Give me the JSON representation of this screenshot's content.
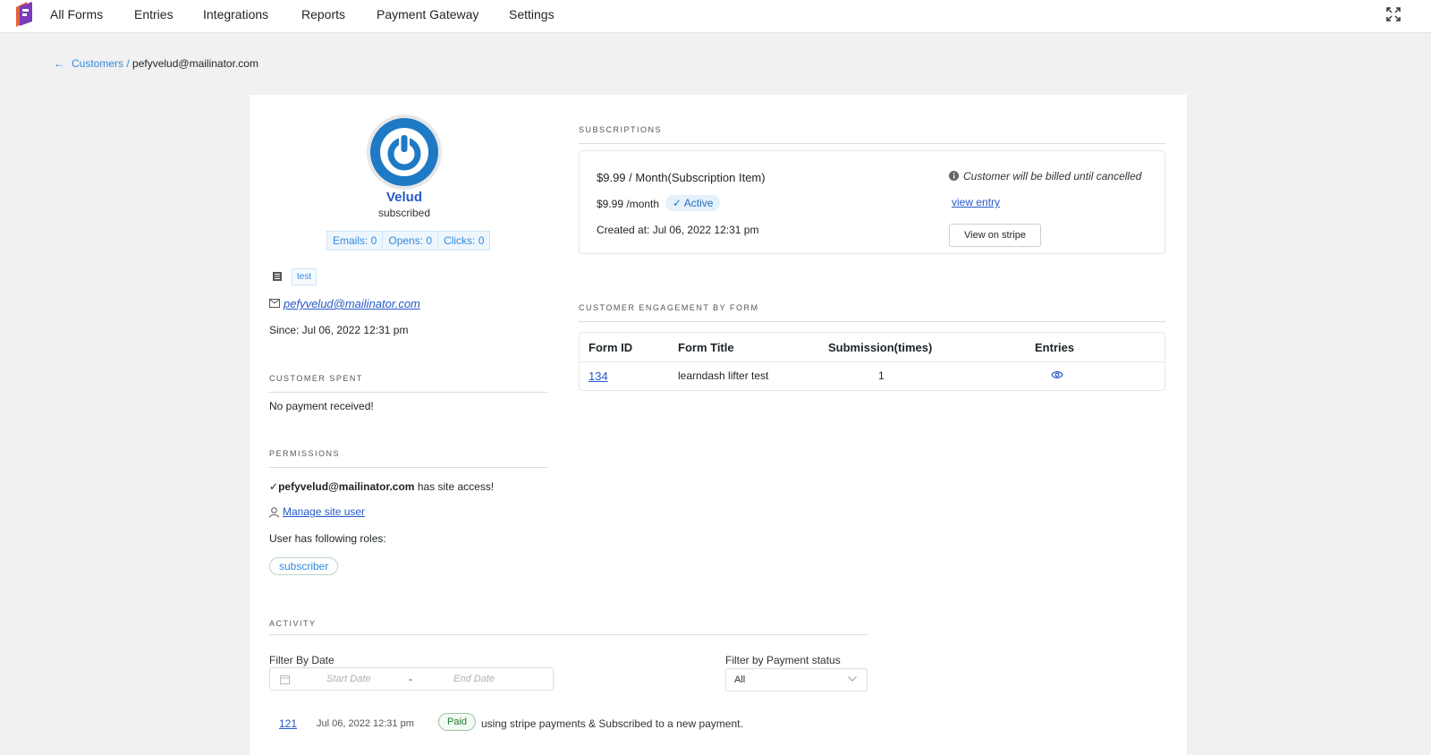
{
  "nav": {
    "items": [
      "All Forms",
      "Entries",
      "Integrations",
      "Reports",
      "Payment Gateway",
      "Settings"
    ]
  },
  "breadcrumb": {
    "parent": "Customers /",
    "current": "pefyvelud@mailinator.com"
  },
  "profile": {
    "name": "Velud",
    "status": "subscribed",
    "stats": [
      "Emails: 0",
      "Opens: 0",
      "Clicks: 0"
    ],
    "tag": "test",
    "email": "pefyvelud@mailinator.com",
    "since": "Since: Jul 06, 2022 12:31 pm"
  },
  "customer_spent": {
    "title": "CUSTOMER SPENT",
    "text": "No payment received!"
  },
  "permissions": {
    "title": "PERMISSIONS",
    "user_email": "pefyvelud@mailinator.com",
    "access_text": " has site access!",
    "manage_link": "Manage site user",
    "roles_text": "User has following roles:",
    "role": "subscriber"
  },
  "subscriptions": {
    "title": "SUBSCRIPTIONS",
    "item": "$9.99 / Month(Subscription Item)",
    "price": "$9.99 /month",
    "status": "Active",
    "created": "Created at: Jul 06, 2022 12:31 pm",
    "billing_note": "Customer will be billed until cancelled",
    "view_entry": "view entry",
    "view_stripe": "View on stripe"
  },
  "engagement": {
    "title": "CUSTOMER ENGAGEMENT BY FORM",
    "headers": [
      "Form ID",
      "Form Title",
      "Submission(times)",
      "Entries"
    ],
    "rows": [
      {
        "form_id": "134",
        "form_title": "learndash lifter test",
        "submissions": "1"
      }
    ]
  },
  "activity": {
    "title": "ACTIVITY",
    "filter_date_label": "Filter By Date",
    "start_placeholder": "Start Date",
    "end_placeholder": "End Date",
    "range_separator": "-",
    "filter_status_label": "Filter by Payment status",
    "status_value": "All",
    "items": [
      {
        "id": "121",
        "date": "Jul 06, 2022 12:31 pm",
        "badge": "Paid",
        "text": "using stripe payments & Subscribed to a new payment."
      }
    ]
  },
  "colors": {
    "accent": "#2f8ae0",
    "link": "#2659c9",
    "avatar": "#1e7ac4",
    "paid": "#1f7a2e"
  }
}
